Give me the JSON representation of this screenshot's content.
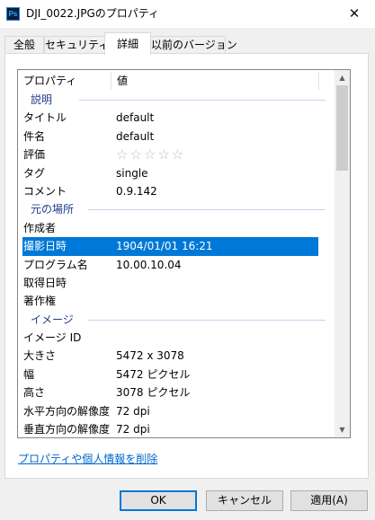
{
  "window": {
    "title": "DJI_0022.JPGのプロパティ",
    "app_icon_text": "Ps",
    "close_glyph": "✕"
  },
  "tabs": [
    {
      "label": "全般",
      "active": false
    },
    {
      "label": "セキュリティ",
      "active": false
    },
    {
      "label": "詳細",
      "active": true
    },
    {
      "label": "以前のバージョン",
      "active": false
    }
  ],
  "list": {
    "header": {
      "property": "プロパティ",
      "value": "値"
    },
    "rows": [
      {
        "type": "section",
        "name": "説明"
      },
      {
        "type": "item",
        "name": "タイトル",
        "value": "default"
      },
      {
        "type": "item",
        "name": "件名",
        "value": "default"
      },
      {
        "type": "rating",
        "name": "評価",
        "value": "☆☆☆☆☆",
        "rating": 0,
        "max": 5
      },
      {
        "type": "item",
        "name": "タグ",
        "value": "single"
      },
      {
        "type": "item",
        "name": "コメント",
        "value": "0.9.142"
      },
      {
        "type": "section",
        "name": "元の場所"
      },
      {
        "type": "item",
        "name": "作成者",
        "value": ""
      },
      {
        "type": "item",
        "name": "撮影日時",
        "value": "1904/01/01 16:21",
        "selected": true
      },
      {
        "type": "item",
        "name": "プログラム名",
        "value": "10.00.10.04"
      },
      {
        "type": "item",
        "name": "取得日時",
        "value": ""
      },
      {
        "type": "item",
        "name": "著作権",
        "value": ""
      },
      {
        "type": "section",
        "name": "イメージ"
      },
      {
        "type": "item",
        "name": "イメージ ID",
        "value": ""
      },
      {
        "type": "item",
        "name": "大きさ",
        "value": "5472 x 3078"
      },
      {
        "type": "item",
        "name": "幅",
        "value": "5472 ピクセル"
      },
      {
        "type": "item",
        "name": "高さ",
        "value": "3078 ピクセル"
      },
      {
        "type": "item",
        "name": "水平方向の解像度",
        "value": "72 dpi"
      },
      {
        "type": "item",
        "name": "垂直方向の解像度",
        "value": "72 dpi"
      }
    ]
  },
  "scrollbar": {
    "up_glyph": "▲",
    "down_glyph": "▼"
  },
  "remove_link": "プロパティや個人情報を削除",
  "buttons": {
    "ok": "OK",
    "cancel": "キャンセル",
    "apply": "適用(A)"
  }
}
